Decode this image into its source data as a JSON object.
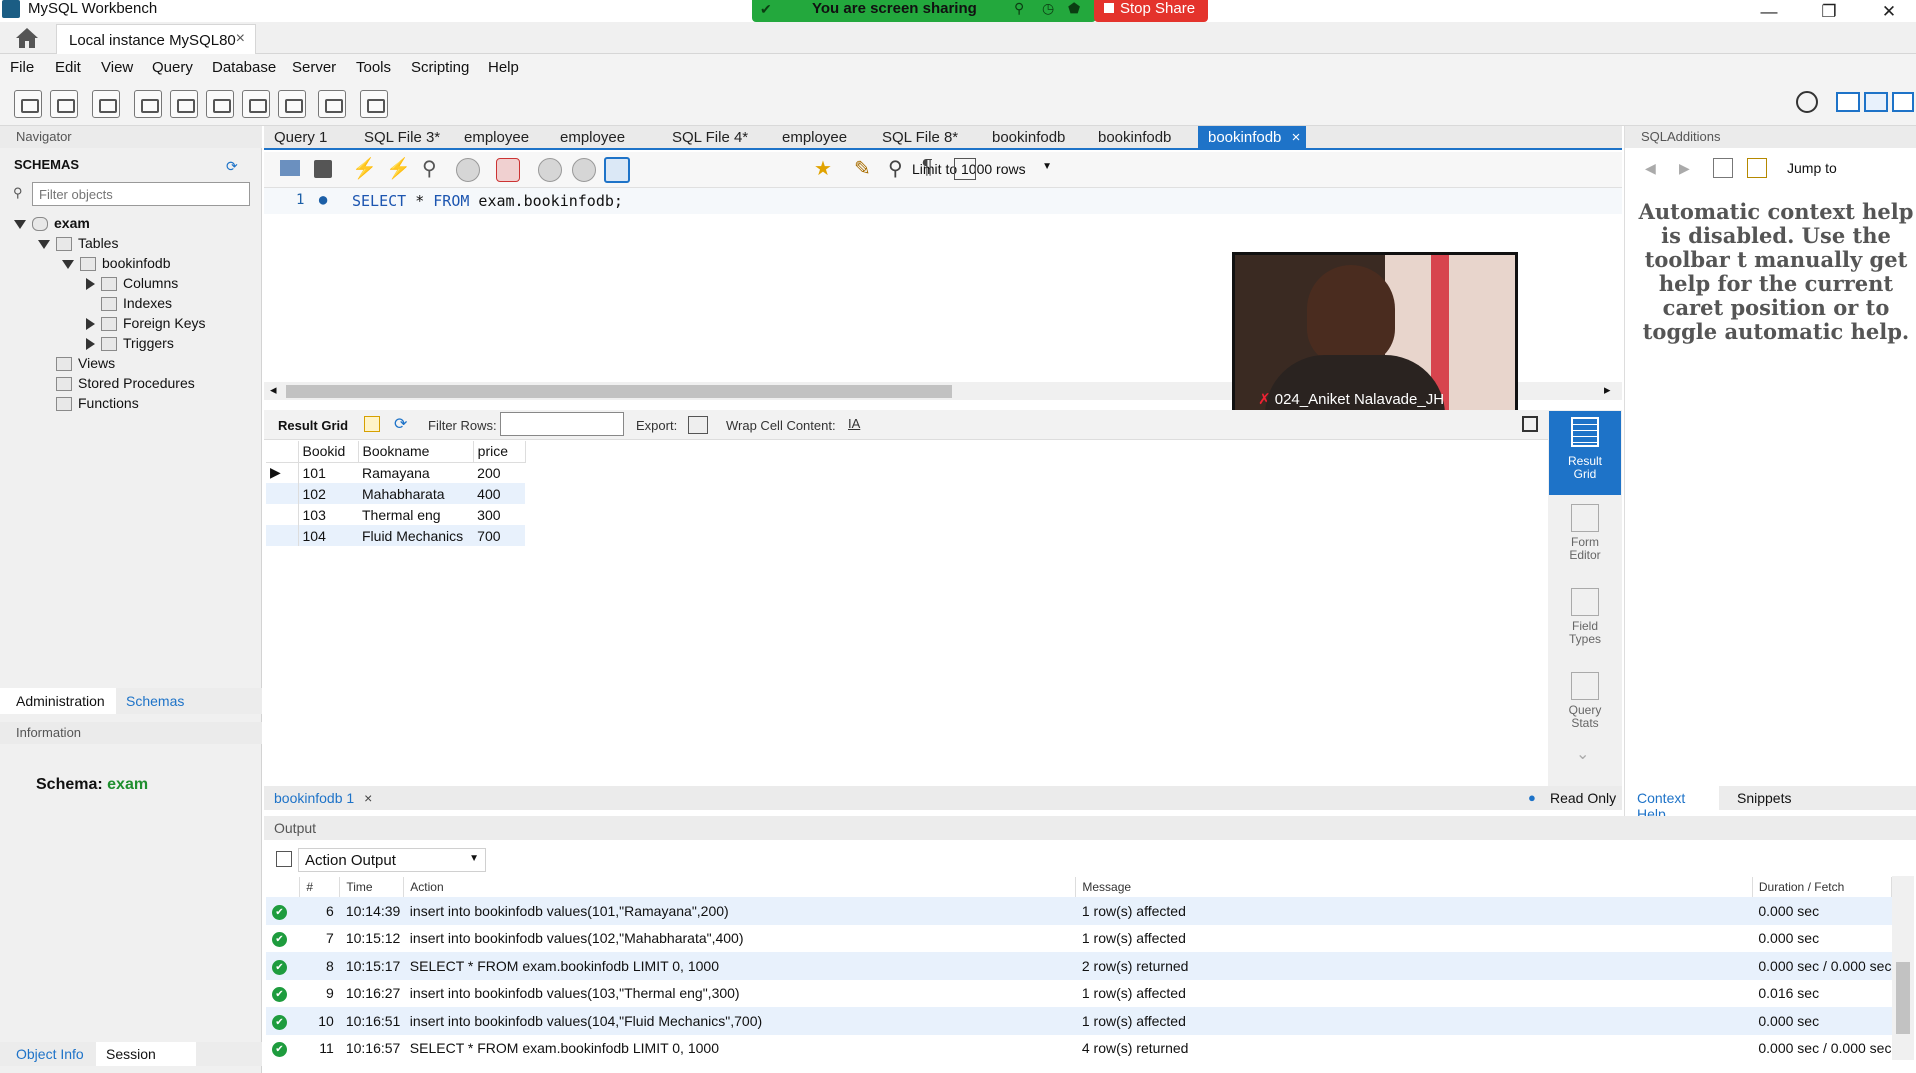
{
  "window": {
    "title": "MySQL Workbench",
    "minimize": "—",
    "restore": "❐",
    "close": "✕"
  },
  "share": {
    "text": "You are screen sharing",
    "stop": "Stop Share"
  },
  "connection_tab": {
    "label": "Local instance MySQL80",
    "close": "×"
  },
  "menu": [
    "File",
    "Edit",
    "View",
    "Query",
    "Database",
    "Server",
    "Tools",
    "Scripting",
    "Help"
  ],
  "navigator": {
    "title": "Navigator",
    "schemas_label": "SCHEMAS",
    "filter_placeholder": "Filter objects",
    "tree": {
      "schema": "exam",
      "tables": "Tables",
      "table": "bookinfodb",
      "columns": "Columns",
      "indexes": "Indexes",
      "foreign_keys": "Foreign Keys",
      "triggers": "Triggers",
      "views": "Views",
      "stored_procedures": "Stored Procedures",
      "functions": "Functions"
    },
    "tabs": [
      "Administration",
      "Schemas"
    ],
    "information_label": "Information",
    "schema_info_label": "Schema:",
    "schema_info_value": "exam",
    "bottom_tabs": [
      "Object Info",
      "Session"
    ]
  },
  "doc_tabs": [
    "Query 1",
    "SQL File 3*",
    "employee",
    "employee",
    "SQL File 4*",
    "employee",
    "SQL File 8*",
    "bookinfodb",
    "bookinfodb",
    "bookinfodb"
  ],
  "editor": {
    "limit": "Limit to 1000 rows",
    "line_number": "1",
    "sql_kw1": "SELECT",
    "sql_star": " * ",
    "sql_kw2": "FROM",
    "sql_rest": " exam.bookinfodb;"
  },
  "video": {
    "name": "024_Aniket Nalavade_JH"
  },
  "result_bar": {
    "result_grid": "Result Grid",
    "filter_rows": "Filter Rows:",
    "export": "Export:",
    "wrap": "Wrap Cell Content:"
  },
  "result_table": {
    "columns": [
      "Bookid",
      "Bookname",
      "price"
    ],
    "rows": [
      [
        "101",
        "Ramayana",
        "200"
      ],
      [
        "102",
        "Mahabharata",
        "400"
      ],
      [
        "103",
        "Thermal eng",
        "300"
      ],
      [
        "104",
        "Fluid Mechanics",
        "700"
      ]
    ]
  },
  "side_panel": {
    "result_grid": "Result Grid",
    "form_editor": "Form Editor",
    "field_types": "Field Types",
    "query_stats": "Query Stats"
  },
  "result_tab": {
    "label": "bookinfodb 1",
    "read_only": "Read Only"
  },
  "output": {
    "title": "Output",
    "selector": "Action Output",
    "columns": [
      "#",
      "Time",
      "Action",
      "Message",
      "Duration / Fetch"
    ],
    "rows": [
      [
        "6",
        "10:14:39",
        "insert into bookinfodb values(101,\"Ramayana\",200)",
        "1 row(s) affected",
        "0.000 sec"
      ],
      [
        "7",
        "10:15:12",
        "insert into bookinfodb values(102,\"Mahabharata\",400)",
        "1 row(s) affected",
        "0.000 sec"
      ],
      [
        "8",
        "10:15:17",
        "SELECT * FROM exam.bookinfodb LIMIT 0, 1000",
        "2 row(s) returned",
        "0.000 sec / 0.000 sec"
      ],
      [
        "9",
        "10:16:27",
        "insert into bookinfodb values(103,\"Thermal eng\",300)",
        "1 row(s) affected",
        "0.016 sec"
      ],
      [
        "10",
        "10:16:51",
        "insert into bookinfodb values(104,\"Fluid Mechanics\",700)",
        "1 row(s) affected",
        "0.000 sec"
      ],
      [
        "11",
        "10:16:57",
        "SELECT * FROM exam.bookinfodb LIMIT 0, 1000",
        "4 row(s) returned",
        "0.000 sec / 0.000 sec"
      ]
    ]
  },
  "sql_additions": {
    "title": "SQLAdditions",
    "jump_to": "Jump to",
    "help_text": "Automatic context help is disabled. Use the toolbar t manually get help for the current caret position or to toggle automatic help.",
    "tabs": [
      "Context Help",
      "Snippets"
    ]
  }
}
